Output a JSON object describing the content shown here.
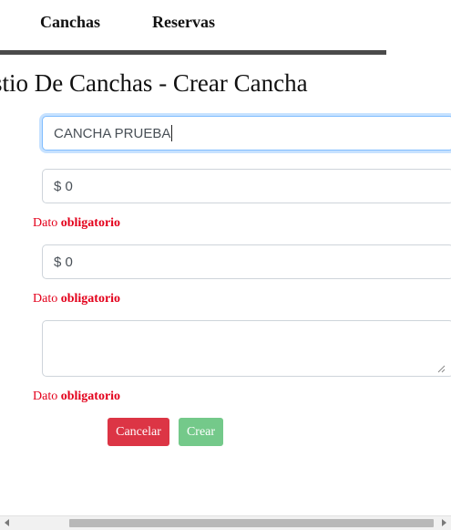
{
  "nav": {
    "items": [
      {
        "label": "Canchas"
      },
      {
        "label": "Reservas"
      }
    ]
  },
  "page": {
    "title": "estio De Canchas - Crear Cancha"
  },
  "form": {
    "name_value": "CANCHA PRUEBA",
    "price_value": "$ 0",
    "price2_value": "$ 0",
    "description_value": "",
    "error_prefix": "Dato",
    "error_word": "obligatorio"
  },
  "buttons": {
    "cancel_label": "Cancelar",
    "create_label": "Crear"
  },
  "colors": {
    "cancel": "#dc3545",
    "create": "#74c98a",
    "error": "#e3001b",
    "focus": "#80bdff"
  }
}
